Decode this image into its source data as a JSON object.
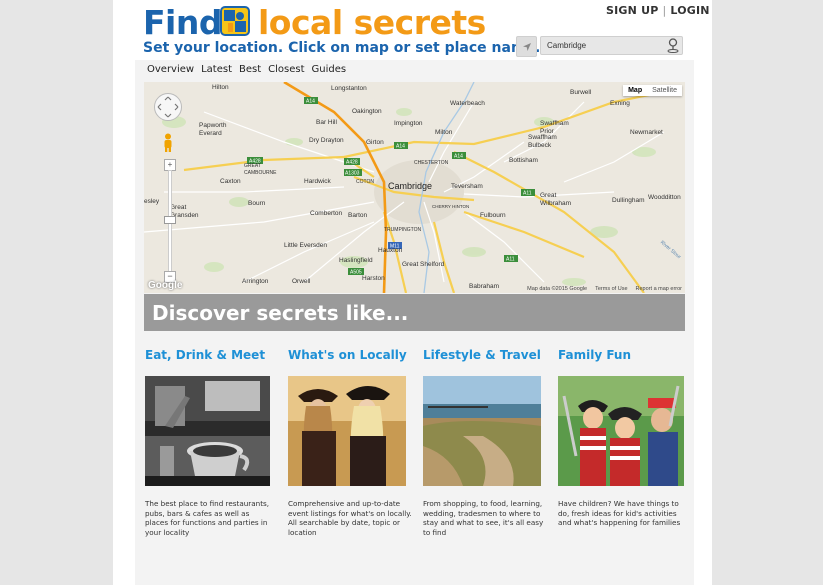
{
  "header": {
    "logo_find": "Find",
    "logo_secrets": "local secrets",
    "tagline": "Set your location. Click on map or set place name.",
    "sign_up": "SIGN UP",
    "login": "LOGIN",
    "location_value": "Cambridge"
  },
  "nav": {
    "items": [
      "Overview",
      "Latest",
      "Best",
      "Closest",
      "Guides"
    ]
  },
  "map": {
    "type_map": "Map",
    "type_satellite": "Satellite",
    "attribution": "Map data ©2015 Google",
    "terms": "Terms of Use",
    "report": "Report a map error",
    "google": "Google",
    "places": {
      "longstanton": "Longstanton",
      "hilton": "Hilton",
      "waterbeach": "Waterbeach",
      "burwell": "Burwell",
      "exning": "Exning",
      "papworth": "Papworth\nEverard",
      "barhill": "Bar Hill",
      "oakington": "Oakington",
      "girton": "Girton",
      "impington": "Impington",
      "swaffham_prior": "Swaffham\nPrior",
      "newmarket": "Newmarket",
      "dry_drayton": "Dry Drayton",
      "milton": "Milton",
      "swaffham_bulbeck": "Swaffham\nBulbeck",
      "great_cambourne": "GREAT\nCAMBOURNE",
      "chesterton": "CHESTERTON",
      "bottisham": "Bottisham",
      "caxton": "Caxton",
      "hardwick": "Hardwick",
      "coton": "COTON",
      "cambridge": "Cambridge",
      "teversham": "Teversham",
      "great_wilbraham": "Great\nWilbraham",
      "dullingham": "Dullingham",
      "woodditton": "Woodditton",
      "great_gransden": "Great\nGransden",
      "bourn": "Bourn",
      "cherry_hinton": "CHERRY HINTON",
      "comberton": "Comberton",
      "barton": "Barton",
      "fulbourn": "Fulbourn",
      "trumpington": "TRUMPINGTON",
      "little_eversden": "Little Eversden",
      "hauxton": "Hauxton",
      "hislingfield": "Haslingfield",
      "great_shelford": "Great Shelford",
      "river_stour": "River Stour",
      "arrington": "Arrington",
      "orwell": "Orwell",
      "harston": "Harston",
      "babraham": "Babraham",
      "esley": "esley"
    },
    "roads": {
      "a14": "A14",
      "a428": "A428",
      "a1303": "A1303",
      "a11": "A11",
      "m11": "M11",
      "a505": "A505"
    }
  },
  "discover": {
    "title": "Discover secrets like..."
  },
  "categories": [
    {
      "title": "Eat, Drink & Meet",
      "description": "The best place to find restaurants, pubs, bars & cafes as well as places for functions and parties in your locality"
    },
    {
      "title": "What's on Locally",
      "description": "Comprehensive and up-to-date event listings for what's on locally. All searchable by date, topic or location"
    },
    {
      "title": "Lifestyle & Travel",
      "description": "From shopping, to food, learning, wedding, tradesmen to where to stay and what to see, it's all easy to find"
    },
    {
      "title": "Family Fun",
      "description": "Have children? We have things to do, fresh ideas for kid's activities and what's happening for families"
    }
  ],
  "colors": {
    "brand_blue": "#1b64ad",
    "brand_orange": "#f39a16",
    "category_blue": "#1e90d6",
    "discover_bar": "#9a9a9a"
  },
  "icons": {
    "locate": "location-arrow-icon",
    "pin": "map-pin-icon",
    "pan": "pan-control-icon",
    "pegman": "street-view-icon",
    "zoom_in": "zoom-in-icon",
    "zoom_out": "zoom-out-icon"
  }
}
